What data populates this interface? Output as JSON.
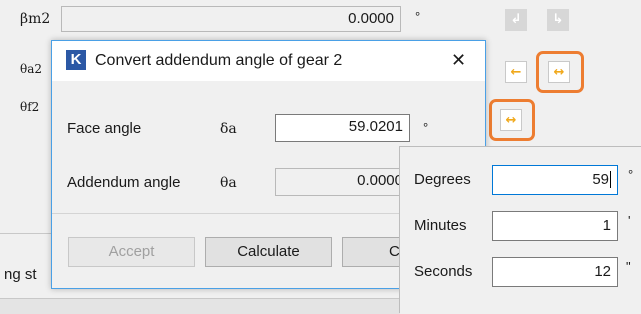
{
  "background_form": {
    "row1_symbol": "βm2",
    "row1_value": "0.0000",
    "row1_unit": "°",
    "row2_symbol": "θa2",
    "row3_symbol": "θf2",
    "partial_label": "ng st"
  },
  "dialog": {
    "title": "Convert addendum angle of gear 2",
    "close_glyph": "✕",
    "logo_letter": "K",
    "face_angle_label": "Face angle",
    "face_angle_symbol": "δa",
    "face_angle_value": "59.0201",
    "face_angle_unit": "°",
    "addendum_angle_label": "Addendum angle",
    "addendum_angle_symbol": "θa",
    "addendum_angle_value": "0.0000",
    "accept_label": "Accept",
    "calculate_label": "Calculate",
    "cancel_label": "Ca"
  },
  "dms_popup": {
    "degrees_label": "Degrees",
    "degrees_value": "59",
    "degrees_unit": "°",
    "minutes_label": "Minutes",
    "minutes_value": "1",
    "minutes_unit": "'",
    "seconds_label": "Seconds",
    "seconds_value": "12",
    "seconds_unit": "\""
  },
  "toolbar_icons": {
    "convert_left": "arrow-left-icon",
    "convert_both": "arrow-both-icon",
    "highlight_color": "#ed7d31",
    "active_arrow_color": "#f0a81a"
  }
}
